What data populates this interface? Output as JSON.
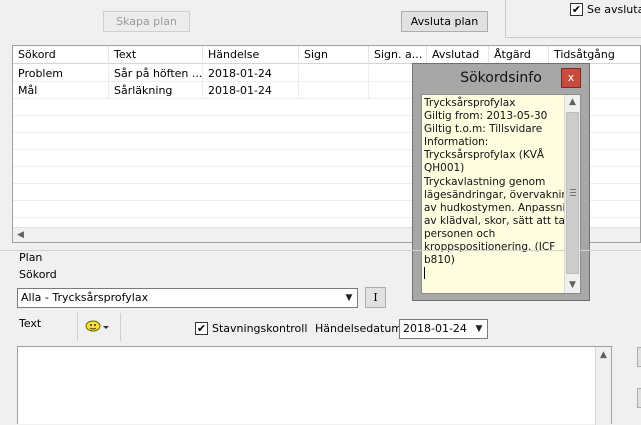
{
  "toolbar": {
    "create_plan_label": "Skapa plan",
    "finish_plan_label": "Avsluta plan",
    "show_finished_label": "Se avslutad"
  },
  "grid": {
    "columns": [
      "Sökord",
      "Text",
      "Händelse",
      "Sign",
      "Sign. a...",
      "Avslutad",
      "Åtgärd",
      "Tidsåtgång"
    ],
    "rows": [
      [
        "Problem",
        "Sår på höften ...",
        "2018-01-24",
        "",
        "",
        "",
        "",
        ""
      ],
      [
        "Mål",
        "Sårläkning",
        "2018-01-24",
        "",
        "",
        "",
        "",
        ""
      ]
    ]
  },
  "popup": {
    "title": "Sökordsinfo",
    "close_label": "x",
    "lines": [
      "Trycksårsprofylax",
      "Giltig from: 2013-05-30",
      "Giltig t.o.m: Tillsvidare",
      "Information:",
      "Trycksårsprofylax (KVÅ",
      "QH001)",
      "Tryckavlastning genom",
      "lägesändringar, övervakning",
      "av hudkostymen. Anpassning",
      "av klädval, skor, sätt att ta i",
      "personen och",
      "kroppspositionering. (ICF",
      "b810)"
    ]
  },
  "plan": {
    "section_label": "Plan",
    "keyword_label": "Sökord",
    "keyword_value": "Alla - Trycksårsprofylax",
    "info_button_label": "I",
    "text_label": "Text",
    "spellcheck_label": "Stavningskontroll",
    "event_date_label": "Händelsedatum",
    "event_date_value": "2018-01-24"
  }
}
